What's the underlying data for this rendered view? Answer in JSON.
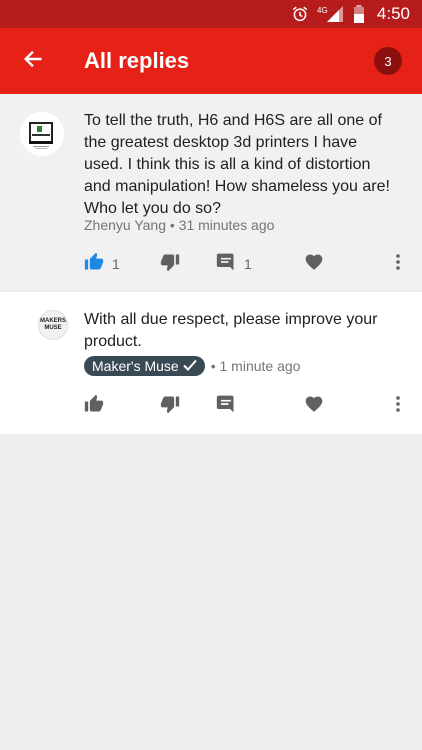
{
  "statusbar": {
    "network": "4G",
    "time": "4:50",
    "icons": [
      "alarm-icon",
      "signal-icon",
      "battery-icon"
    ]
  },
  "appbar": {
    "title": "All replies",
    "count": "3",
    "back_icon": "arrow-left-icon"
  },
  "comments": [
    {
      "text": "To tell the truth, H6 and H6S are all one of the greatest desktop 3d printers I have used. I think this is all a kind of distortion and manipulation! How shameless you are! Who let you do so?",
      "author": "Zhenyu Yang",
      "time": "31 minutes ago",
      "likes": "1",
      "replies": "1",
      "liked": true
    },
    {
      "text": "With all due respect, please improve your product.",
      "author": "Maker's Muse",
      "time": "1 minute ago",
      "avatar_text_1": "MAKERS",
      "avatar_text_2": "MUSE",
      "verified": true
    }
  ],
  "colors": {
    "statusbar": "#b71c1c",
    "appbar": "#e62117",
    "badge": "#8b0f0f",
    "like_active": "#1e88e5",
    "icon_gray": "#606060"
  }
}
